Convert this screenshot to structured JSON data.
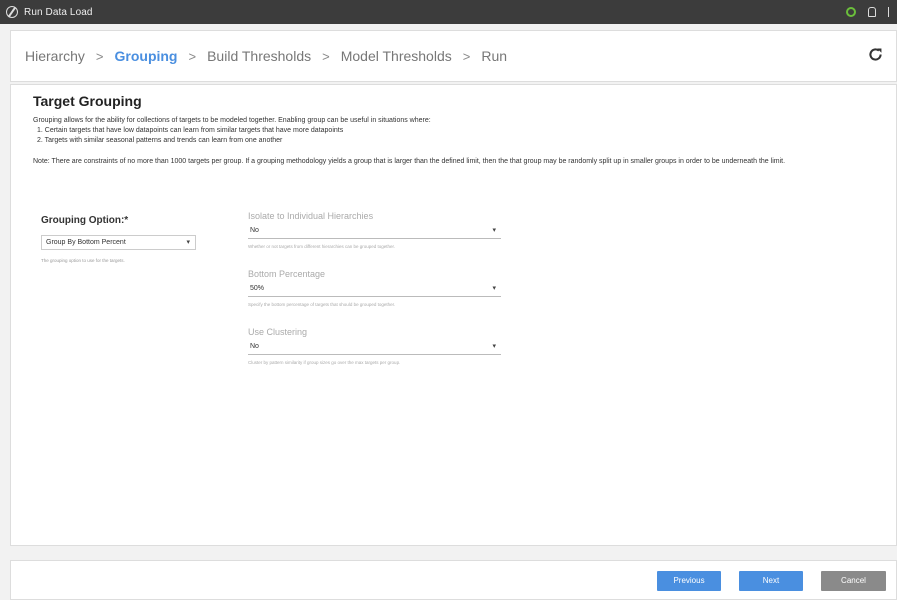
{
  "window": {
    "title": "Run Data Load"
  },
  "steps": [
    {
      "label": "Hierarchy"
    },
    {
      "label": "Grouping",
      "active": true
    },
    {
      "label": "Build Thresholds"
    },
    {
      "label": "Model Thresholds"
    },
    {
      "label": "Run"
    }
  ],
  "step_separator": ">",
  "main": {
    "title": "Target Grouping",
    "description": "Grouping allows for the ability for collections of targets to be modeled together. Enabling group can be useful in situations where:",
    "points": [
      "1. Certain targets that have low datapoints can learn from similar targets that have more datapoints",
      "2. Targets with similar seasonal patterns and trends can learn from one another"
    ],
    "note": "Note: There are constraints of no more than 1000 targets per group. If a grouping methodology yields a group that is larger than the defined limit, then the that group may be randomly split up in smaller groups in order to be underneath the limit."
  },
  "grouping_option": {
    "label": "Grouping Option:*",
    "value": "Group By Bottom Percent",
    "help": "The grouping option to use for the targets."
  },
  "fields": {
    "isolate": {
      "label": "Isolate to Individual Hierarchies",
      "value": "No",
      "help": "Whether or not targets from different hierarchies can be grouped together."
    },
    "bottom_percentage": {
      "label": "Bottom Percentage",
      "value": "50%",
      "help": "Specify the bottom percentage of targets that should be grouped together."
    },
    "use_clustering": {
      "label": "Use Clustering",
      "value": "No",
      "help": "Cluster by pattern similarity if group sizes go over the max targets per group."
    }
  },
  "footer": {
    "previous": "Previous",
    "next": "Next",
    "cancel": "Cancel"
  },
  "colors": {
    "accent": "#4a8fe0",
    "cancel": "#8a8a8a",
    "titlebar": "#3c3c3c",
    "status_ok": "#6bbf3b"
  },
  "icons": {
    "app": "app-logo-icon",
    "status": "status-circle-icon",
    "notification": "bell-icon",
    "more": "more-icon",
    "refresh": "refresh-icon",
    "caret": "chevron-down-icon"
  }
}
